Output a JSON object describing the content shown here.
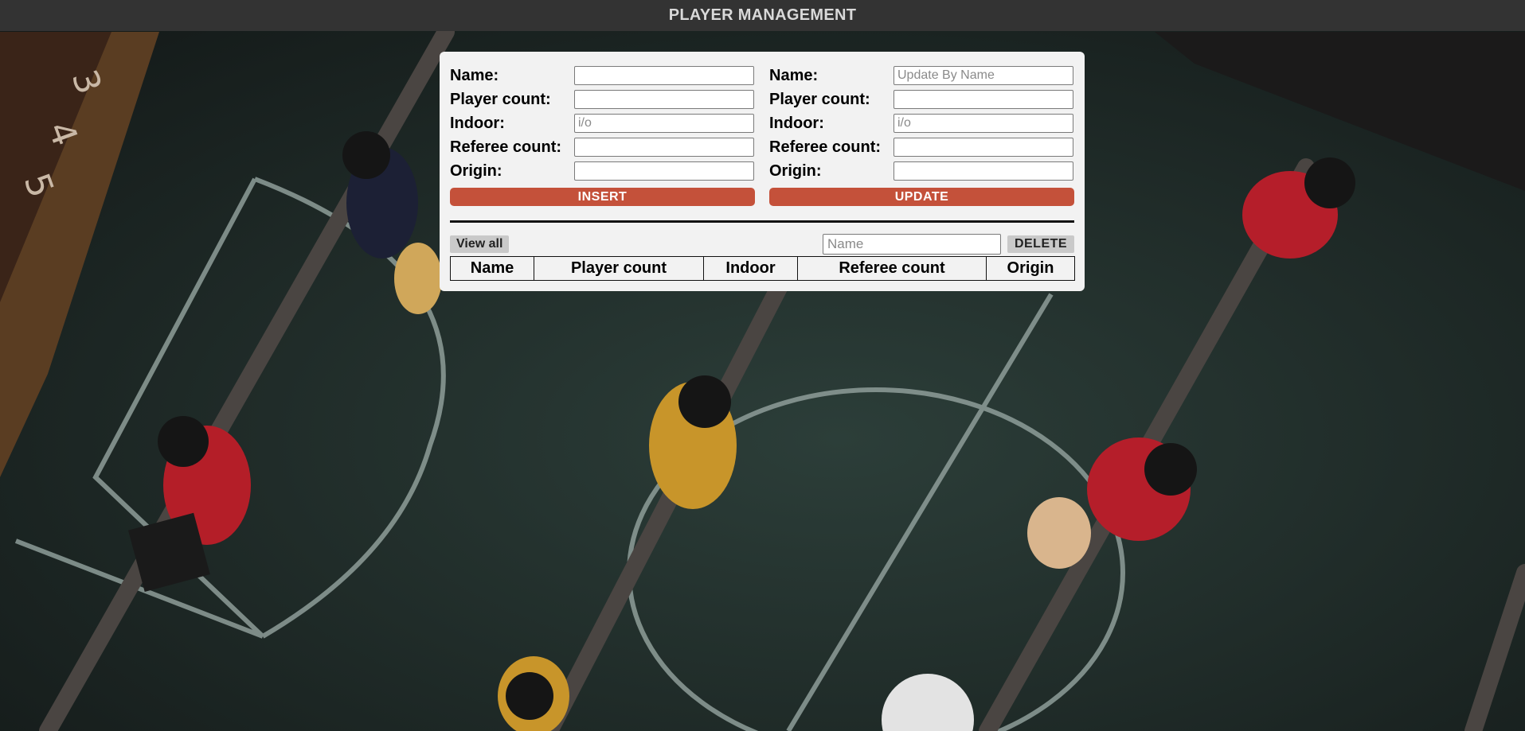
{
  "header": {
    "title": "PLAYER MANAGEMENT"
  },
  "insert_form": {
    "fields": [
      {
        "label": "Name:",
        "value": "",
        "placeholder": ""
      },
      {
        "label": "Player count:",
        "value": "",
        "placeholder": ""
      },
      {
        "label": "Indoor:",
        "value": "",
        "placeholder": "i/o"
      },
      {
        "label": "Referee count:",
        "value": "",
        "placeholder": ""
      },
      {
        "label": "Origin:",
        "value": "",
        "placeholder": ""
      }
    ],
    "button_label": "INSERT"
  },
  "update_form": {
    "fields": [
      {
        "label": "Name:",
        "value": "",
        "placeholder": "Update By Name"
      },
      {
        "label": "Player count:",
        "value": "",
        "placeholder": ""
      },
      {
        "label": "Indoor:",
        "value": "",
        "placeholder": "i/o"
      },
      {
        "label": "Referee count:",
        "value": "",
        "placeholder": ""
      },
      {
        "label": "Origin:",
        "value": "",
        "placeholder": ""
      }
    ],
    "button_label": "UPDATE"
  },
  "toolbar": {
    "view_all_label": "View all",
    "delete_placeholder": "Name",
    "delete_label": "DELETE"
  },
  "table": {
    "columns": [
      "Name",
      "Player count",
      "Indoor",
      "Referee count",
      "Origin"
    ],
    "rows": []
  },
  "colors": {
    "header_bg": "#333333",
    "accent_button": "#c4513a",
    "panel_bg": "#f2f2f2"
  }
}
